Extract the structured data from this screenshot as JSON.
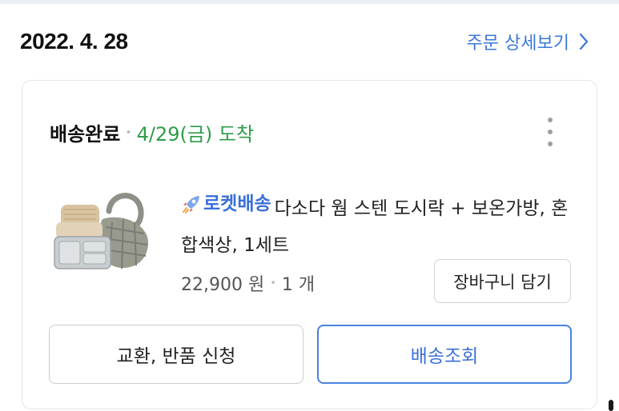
{
  "order": {
    "date": "2022. 4. 28",
    "detail_link_label": "주문 상세보기"
  },
  "shipment": {
    "status_label": "배송완료",
    "arrival_text": "4/29(금) 도착",
    "status_color": "#2e9c4a"
  },
  "product": {
    "badge_label": "로켓배송",
    "badge_icon": "rocket-icon",
    "name": "다소다 웜 스텐 도시락 + 보온가방, 혼합색상, 1세트",
    "price": "22,900 원",
    "quantity": "1 개",
    "thumbnail_icon": "lunchbox-product-image"
  },
  "actions": {
    "add_to_cart_label": "장바구니 담기",
    "exchange_return_label": "교환, 반품 신청",
    "tracking_label": "배송조회"
  },
  "colors": {
    "accent_blue": "#3a77d8",
    "tracking_border": "#4a82e0",
    "delivered_green": "#2e9c4a"
  }
}
